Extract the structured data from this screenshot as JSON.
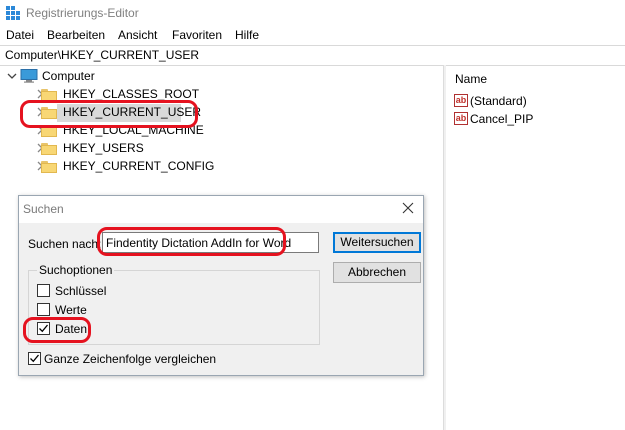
{
  "window": {
    "title": "Registrierungs-Editor"
  },
  "menu": [
    "Datei",
    "Bearbeiten",
    "Ansicht",
    "Favoriten",
    "Hilfe"
  ],
  "address": "Computer\\HKEY_CURRENT_USER",
  "tree": {
    "root": "Computer",
    "keys": [
      "HKEY_CLASSES_ROOT",
      "HKEY_CURRENT_USER",
      "HKEY_LOCAL_MACHINE",
      "HKEY_USERS",
      "HKEY_CURRENT_CONFIG"
    ],
    "selected_index": 1
  },
  "values_pane": {
    "column_name": "Name",
    "items": [
      {
        "icon": "ab",
        "name": "(Standard)"
      },
      {
        "icon": "ab",
        "name": "Cancel_PIP"
      }
    ]
  },
  "dialog": {
    "title": "Suchen",
    "find_label": "Suchen nach:",
    "find_value": "Findentity Dictation AddIn for Word",
    "find_next_button": "Weitersuchen",
    "cancel_button": "Abbrechen",
    "options_group": "Suchoptionen",
    "options": [
      {
        "label": "Schlüssel",
        "checked": false
      },
      {
        "label": "Werte",
        "checked": false
      },
      {
        "label": "Daten",
        "checked": true
      }
    ],
    "match_whole": {
      "label": "Ganze Zeichenfolge vergleichen",
      "checked": true
    }
  },
  "colors": {
    "annotation": "#e5121f",
    "folder": "#f8d775",
    "selection": "#d9d9d9"
  }
}
